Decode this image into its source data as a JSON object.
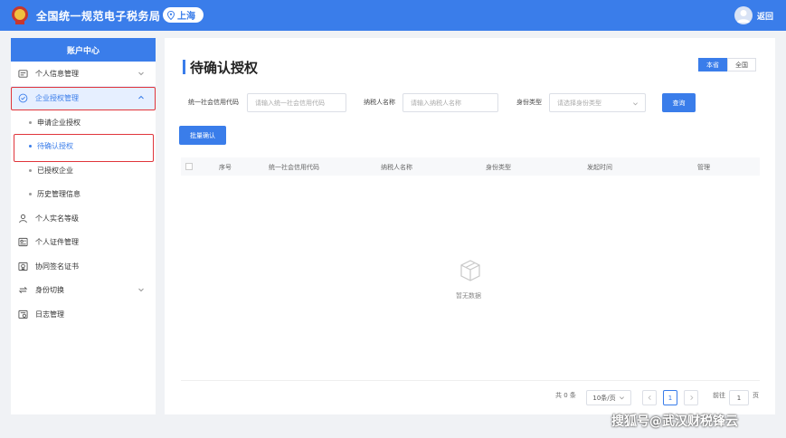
{
  "header": {
    "title": "全国统一规范电子税务局",
    "region": "上海",
    "back_label": "返回"
  },
  "sidebar": {
    "title": "账户中心",
    "items": [
      {
        "label": "个人信息管理",
        "icon": "id-card-icon",
        "expandable": true
      },
      {
        "label": "企业授权管理",
        "icon": "shield-check-icon",
        "expandable": true,
        "expanded": true
      },
      {
        "label": "个人实名等级",
        "icon": "user-icon"
      },
      {
        "label": "个人证件管理",
        "icon": "certificate-icon"
      },
      {
        "label": "协同签名证书",
        "icon": "signature-icon"
      },
      {
        "label": "身份切换",
        "icon": "switch-icon",
        "expandable": true
      },
      {
        "label": "日志管理",
        "icon": "log-icon"
      }
    ],
    "sub_items": [
      {
        "label": "申请企业授权"
      },
      {
        "label": "待确认授权",
        "active": true
      },
      {
        "label": "已授权企业"
      },
      {
        "label": "历史管理信息"
      }
    ]
  },
  "main": {
    "title": "待确认授权",
    "scope": {
      "local": "本省",
      "national": "全国"
    },
    "filters": {
      "credit_code_label": "统一社会信用代码",
      "credit_code_placeholder": "请输入统一社会信用代码",
      "taxpayer_label": "纳税人名称",
      "taxpayer_placeholder": "请输入纳税人名称",
      "identity_label": "身份类型",
      "identity_placeholder": "请选择身份类型",
      "query_label": "查询"
    },
    "batch_confirm_label": "批量确认",
    "table": {
      "columns": [
        "序号",
        "统一社会信用代码",
        "纳税人名称",
        "身份类型",
        "发起时间",
        "管理"
      ],
      "empty_text": "暂无数据"
    },
    "pagination": {
      "total": "共 0 条",
      "page_size": "10条/页",
      "current": "1",
      "goto_label": "前往",
      "goto_value": "1",
      "page_unit": "页"
    }
  },
  "colors": {
    "primary": "#3a7dea",
    "highlight": "#e0353b"
  },
  "watermark": "搜狐号@武汉财税锋云"
}
